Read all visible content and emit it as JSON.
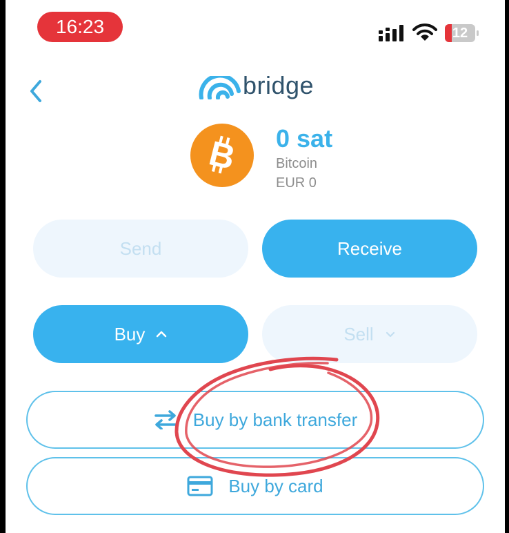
{
  "status_bar": {
    "time": "16:23",
    "battery": "12"
  },
  "header": {
    "brand": "bridge"
  },
  "asset": {
    "amount": "0 sat",
    "name": "Bitcoin",
    "fiat": "EUR 0"
  },
  "actions": {
    "send": "Send",
    "receive": "Receive",
    "buy": "Buy",
    "sell": "Sell"
  },
  "buy_options": [
    {
      "label": "Buy by bank transfer",
      "icon": "transfer-arrows-icon"
    },
    {
      "label": "Buy by card",
      "icon": "credit-card-icon"
    }
  ],
  "colors": {
    "accent": "#38b2ee",
    "bitcoin": "#f4921e",
    "annotation": "#e0464f",
    "time_pill": "#e5343a"
  }
}
